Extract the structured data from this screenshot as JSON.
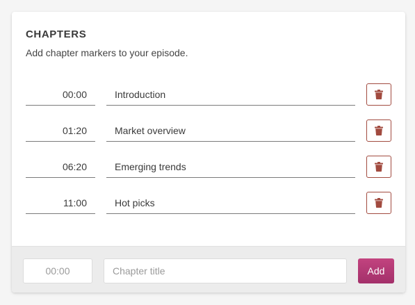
{
  "panel": {
    "title": "CHAPTERS",
    "subtitle": "Add chapter markers to your episode."
  },
  "chapters": [
    {
      "time": "00:00",
      "title": "Introduction"
    },
    {
      "time": "01:20",
      "title": "Market overview"
    },
    {
      "time": "06:20",
      "title": "Emerging trends"
    },
    {
      "time": "11:00",
      "title": "Hot picks"
    }
  ],
  "new_chapter": {
    "time_placeholder": "00:00",
    "title_placeholder": "Chapter title",
    "time_value": "",
    "title_value": "",
    "add_label": "Add"
  },
  "icons": {
    "delete": "trash-icon"
  },
  "colors": {
    "accent": "#c2437f",
    "accent_dark": "#a3306a",
    "delete": "#a14a3f"
  }
}
